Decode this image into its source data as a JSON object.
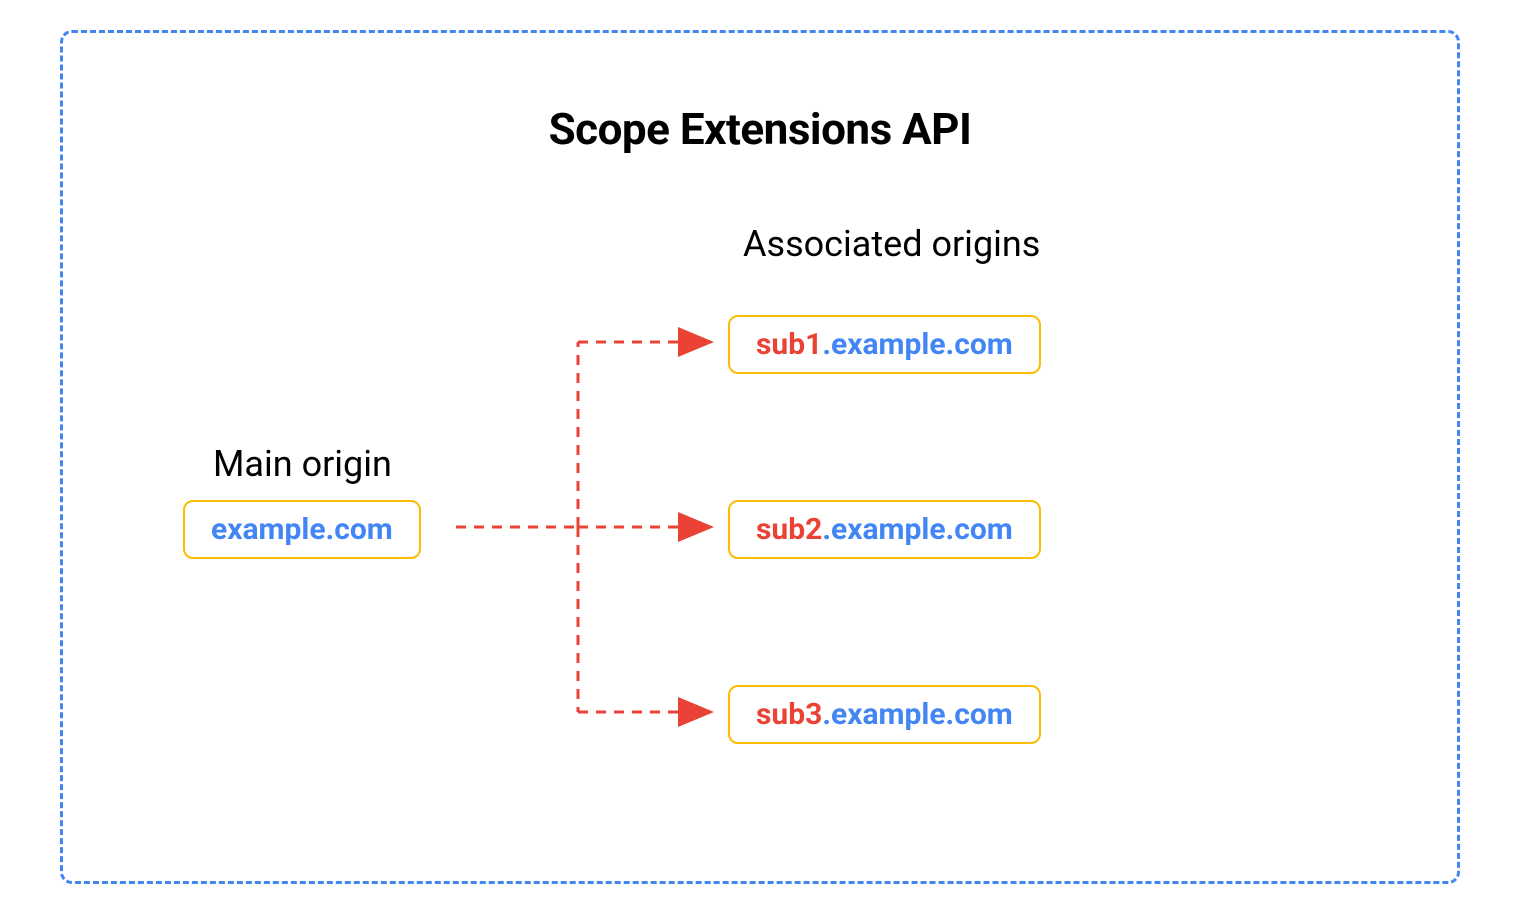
{
  "title": "Scope Extensions API",
  "main_origin": {
    "label": "Main origin",
    "domain": "example.com"
  },
  "associated": {
    "label": "Associated origins",
    "origins": [
      {
        "subdomain": "sub1",
        "domain": ".example.com"
      },
      {
        "subdomain": "sub2",
        "domain": ".example.com"
      },
      {
        "subdomain": "sub3",
        "domain": ".example.com"
      }
    ]
  },
  "colors": {
    "border_dashed": "#4285F4",
    "box_border": "#FBBC04",
    "domain_text": "#4285F4",
    "subdomain_text": "#EA4335",
    "arrow": "#EA4335"
  }
}
